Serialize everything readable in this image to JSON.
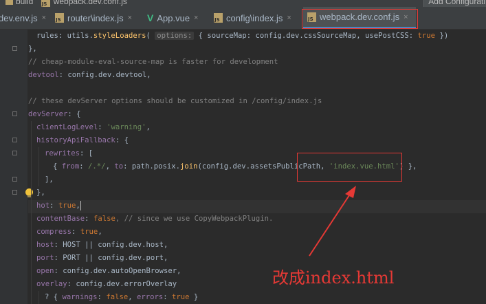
{
  "breadcrumb": {
    "folder": "build",
    "file": "webpack.dev.conf.js"
  },
  "add_config": "Add Configurati",
  "tabs": [
    {
      "label": "dev.env.js",
      "icon": "js-file-icon",
      "active": false
    },
    {
      "label": "router\\index.js",
      "icon": "js-file-icon",
      "active": false
    },
    {
      "label": "App.vue",
      "icon": "vue-file-icon",
      "active": false
    },
    {
      "label": "config\\index.js",
      "icon": "js-file-icon",
      "active": false
    },
    {
      "label": "webpack.dev.conf.js",
      "icon": "js-file-icon",
      "active": true
    }
  ],
  "close_glyph": "×",
  "code": {
    "l1": {
      "a": "rules: utils.",
      "fn": "styleLoaders",
      "b": "( ",
      "hint": "options:",
      "c": " { sourceMap: config.dev.cssSourceMap, usePostCSS: ",
      "kw": "true",
      "d": " })"
    },
    "l2": "},",
    "l3": "// cheap-module-eval-source-map is faster for development",
    "l4": {
      "prop": "devtool",
      "rest": ": config.dev.devtool,"
    },
    "l5": "",
    "l6": "// these devServer options should be customized in /config/index.js",
    "l7": {
      "prop": "devServer",
      "rest": ": {"
    },
    "l8": {
      "prop": "clientLogLevel",
      "a": ": ",
      "str": "'warning'",
      "b": ","
    },
    "l9": {
      "prop": "historyApiFallback",
      "rest": ": {"
    },
    "l10": {
      "prop": "rewrites",
      "rest": ": ["
    },
    "l11": {
      "a": "{ ",
      "p1": "from",
      "b": ": ",
      "rx": "/.*/",
      "c": ", ",
      "p2": "to",
      "d": ": path.posix.",
      "fn": "join",
      "e": "(config.dev.assetsPublicPath, ",
      "str": "'index.vue.html'",
      "f": ") },"
    },
    "l12": "],",
    "l13": "},",
    "l14": {
      "prop": "hot",
      "a": ": ",
      "kw": "true",
      "b": ","
    },
    "l15": {
      "prop": "contentBase",
      "a": ": ",
      "kw": "false",
      "cm": ", // since we use CopyWebpackPlugin."
    },
    "l16": {
      "prop": "compress",
      "a": ": ",
      "kw": "true",
      "b": ","
    },
    "l17": {
      "prop": "host",
      "rest": ": HOST || config.dev.host,"
    },
    "l18": {
      "prop": "port",
      "rest": ": PORT || config.dev.port,"
    },
    "l19": {
      "prop": "open",
      "rest": ": config.dev.autoOpenBrowser,"
    },
    "l20": {
      "prop": "overlay",
      "rest": ": config.dev.errorOverlay"
    },
    "l21": {
      "a": "? { ",
      "p1": "warnings",
      "b": ": ",
      "k1": "false",
      "c": ", ",
      "p2": "errors",
      "d": ": ",
      "k2": "true",
      "e": " }"
    }
  },
  "annotation": "改成index.html",
  "colors": {
    "annotation_red": "#e53935",
    "editor_bg": "#2b2b2b",
    "keyword": "#cc7832",
    "string": "#6a8759",
    "property": "#9876aa",
    "comment": "#808080"
  }
}
